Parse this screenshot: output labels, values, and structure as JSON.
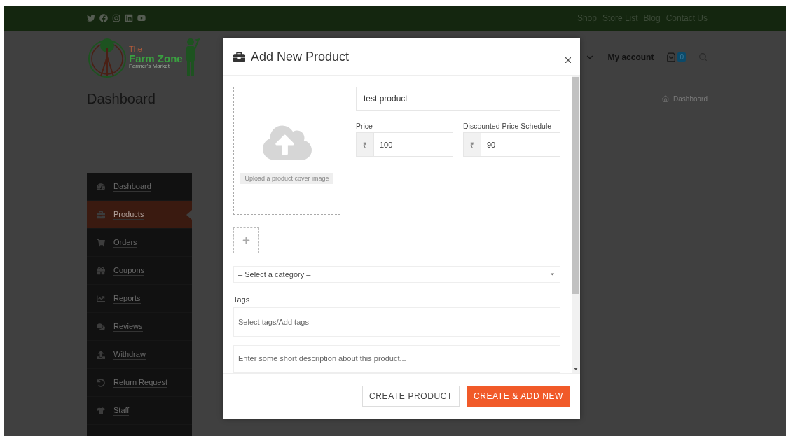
{
  "top_nav": [
    "Shop",
    "Store List",
    "Blog",
    "Contact Us"
  ],
  "logo": {
    "line1": "The",
    "line2": "Farm Zone",
    "line3": "Farmer's Market"
  },
  "header": {
    "account": "My account",
    "cart_count": "0"
  },
  "page_title": "Dashboard",
  "breadcrumb": "Dashboard",
  "sidebar": {
    "items": [
      {
        "label": "Dashboard",
        "selected": false
      },
      {
        "label": "Products",
        "selected": true
      },
      {
        "label": "Orders",
        "selected": false
      },
      {
        "label": "Coupons",
        "selected": false
      },
      {
        "label": "Reports",
        "selected": false
      },
      {
        "label": "Reviews",
        "selected": false
      },
      {
        "label": "Withdraw",
        "selected": false
      },
      {
        "label": "Return Request",
        "selected": false
      },
      {
        "label": "Staff",
        "selected": false
      }
    ]
  },
  "modal": {
    "title": "Add New Product",
    "name_value": "test product",
    "upload_label": "Upload a product cover image",
    "price_fields": [
      {
        "label": "Price",
        "currency": "₹",
        "value": "100"
      },
      {
        "label": "Discounted Price Schedule",
        "currency": "₹",
        "value": "90"
      }
    ],
    "category_placeholder": "– Select a category –",
    "tags_label": "Tags",
    "tags_placeholder": "Select tags/Add tags",
    "description_placeholder": "Enter some short description about this product...",
    "buttons": [
      {
        "label": "CREATE PRODUCT",
        "kind": "secondary"
      },
      {
        "label": "CREATE & ADD NEW",
        "kind": "primary"
      }
    ]
  }
}
